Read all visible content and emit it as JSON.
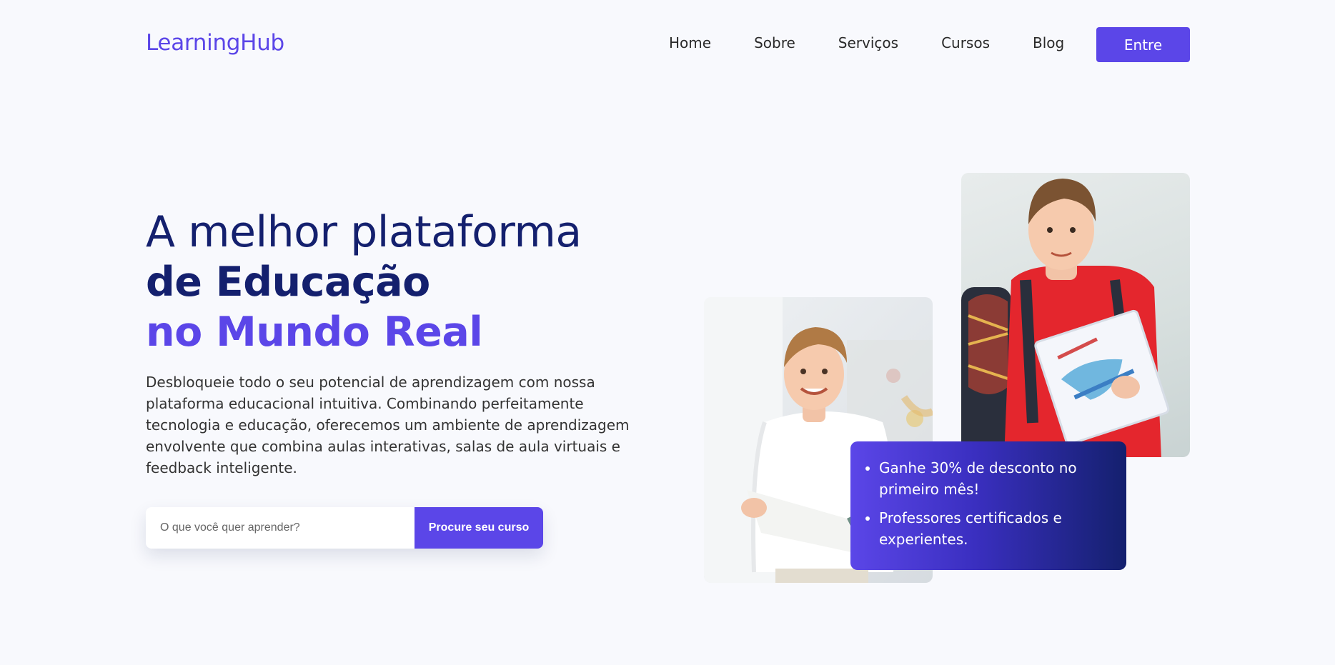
{
  "header": {
    "logo": "LearningHub",
    "nav": [
      "Home",
      "Sobre",
      "Serviços",
      "Cursos",
      "Blog"
    ],
    "cta_label": "Entre"
  },
  "hero": {
    "title_line1": "A melhor plataforma",
    "title_line2": "de Educação",
    "title_line3": "no Mundo Real",
    "description": "Desbloqueie todo o seu potencial de aprendizagem com nossa plataforma educacional intuitiva. Combinando perfeitamente tecnologia e educação, oferecemos um ambiente de aprendizagem envolvente que combina aulas interativas, salas de aula virtuais e feedback inteligente."
  },
  "search": {
    "placeholder": "O que você quer aprender?",
    "button_label": "Procure seu curso"
  },
  "promo": {
    "items": [
      "Ganhe 30% de desconto no primeiro mês!",
      "Professores certificados e experientes."
    ]
  },
  "colors": {
    "accent": "#5b46e8",
    "navy": "#14206e",
    "background": "#f8f9fd"
  }
}
